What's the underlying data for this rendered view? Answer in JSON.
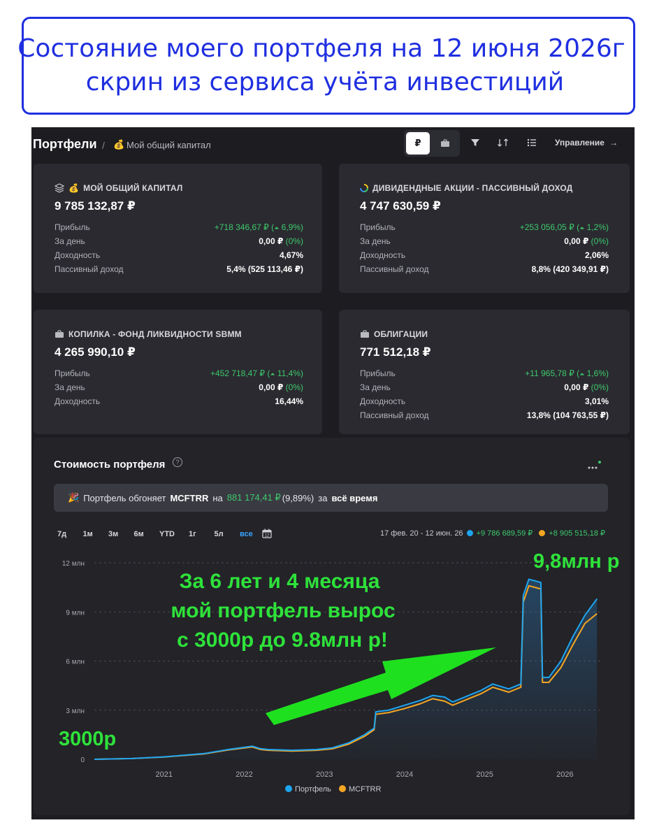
{
  "banner": {
    "line1": "Состояние моего портфеля на 12 июня 2026г",
    "line2": "скрин из сервиса учёта инвестиций"
  },
  "breadcrumb": {
    "title": "Портфели",
    "separator": "/",
    "icon": "money-bag-icon",
    "current": "Мой общий капитал"
  },
  "toolbar": {
    "currency_label": "₽",
    "manage_label": "Управление",
    "manage_arrow": "→"
  },
  "cards": [
    {
      "title": "МОЙ ОБЩИЙ КАПИТАЛ",
      "total": "9 785 132,87 ₽",
      "rows": [
        {
          "label": "Прибыль",
          "value": "+718 346,67 ₽ (",
          "pct": "6,9%",
          "tail": ")",
          "kind": "profit"
        },
        {
          "label": "За день",
          "value": "0,00 ₽ ",
          "pct": "(0%)",
          "kind": "day"
        },
        {
          "label": "Доходность",
          "value": "4,67%",
          "kind": "plain"
        },
        {
          "label": "Пассивный доход",
          "value": "5,4% (525 113,46 ₽)",
          "kind": "plain"
        }
      ]
    },
    {
      "title": "ДИВИДЕНДНЫЕ АКЦИИ - ПАССИВНЫЙ ДОХОД",
      "total": "4 747 630,59 ₽",
      "rows": [
        {
          "label": "Прибыль",
          "value": "+253 056,05 ₽ (",
          "pct": "1,2%",
          "tail": ")",
          "kind": "profit"
        },
        {
          "label": "За день",
          "value": "0,00 ₽ ",
          "pct": "(0%)",
          "kind": "day"
        },
        {
          "label": "Доходность",
          "value": "2,06%",
          "kind": "plain"
        },
        {
          "label": "Пассивный доход",
          "value": "8,8% (420 349,91 ₽)",
          "kind": "plain"
        }
      ]
    },
    {
      "title": "КОПИЛКА - ФОНД ЛИКВИДНОСТИ SBMM",
      "total": "4 265 990,10 ₽",
      "rows": [
        {
          "label": "Прибыль",
          "value": "+452 718,47 ₽ (",
          "pct": "11,4%",
          "tail": ")",
          "kind": "profit"
        },
        {
          "label": "За день",
          "value": "0,00 ₽ ",
          "pct": "(0%)",
          "kind": "day"
        },
        {
          "label": "Доходность",
          "value": "16,44%",
          "kind": "plain"
        }
      ]
    },
    {
      "title": "ОБЛИГАЦИИ",
      "total": "771 512,18 ₽",
      "rows": [
        {
          "label": "Прибыль",
          "value": "+11 965,78 ₽ (",
          "pct": "1,6%",
          "tail": ")",
          "kind": "profit"
        },
        {
          "label": "За день",
          "value": "0,00 ₽ ",
          "pct": "(0%)",
          "kind": "day"
        },
        {
          "label": "Доходность",
          "value": "3,01%",
          "kind": "plain"
        },
        {
          "label": "Пассивный доход",
          "value": "13,8% (104 763,55 ₽)",
          "kind": "plain"
        }
      ]
    }
  ],
  "chart_panel": {
    "title": "Стоимость портфеля",
    "help": "?",
    "notice": {
      "icon": "🎉",
      "pre": "Портфель обгоняет",
      "ticker": "MCFTRR",
      "mid": "на",
      "amount": "881 174,41 ₽",
      "pct": "(9,89%)",
      "post": "за",
      "period": "всё время"
    },
    "periods": [
      "7д",
      "1м",
      "3м",
      "6м",
      "YTD",
      "1г",
      "5л",
      "все"
    ],
    "active_period": "все",
    "range": "17 фев. 20 - 12 июн. 26",
    "portfolio_change": "+9 786 689,59 ₽",
    "index_change": "+8 905 515,18 ₽"
  },
  "annotations": {
    "start": "3000р",
    "end": "9,8млн р",
    "caption_l1": "За 6 лет и 4 месяца",
    "caption_l2": "мой портфель вырос",
    "caption_l3": "с 3000р до 9.8млн р!"
  },
  "colors": {
    "portfolio": "#1ea5f0",
    "index": "#f5a623",
    "annotation": "#2ee23a",
    "accent": "#3aa5ff",
    "profit": "#3ec96c"
  },
  "chart_data": {
    "type": "line",
    "y_ticks": [
      "0",
      "3 млн",
      "6 млн",
      "9 млн",
      "12 млн"
    ],
    "y_tick_values": [
      0,
      3,
      6,
      9,
      12
    ],
    "x_ticks": [
      "2021",
      "2022",
      "2023",
      "2024",
      "2025",
      "2026"
    ],
    "x_tick_values": [
      2021,
      2022,
      2023,
      2024,
      2025,
      2026
    ],
    "xlim": [
      2020.13,
      2026.45
    ],
    "ylim": [
      0,
      12
    ],
    "y_unit": "млн ₽",
    "legend": [
      "Портфель",
      "MCFTRR"
    ],
    "legend_position": "bottom",
    "series": [
      {
        "name": "Портфель",
        "x": [
          2020.13,
          2020.6,
          2021.0,
          2021.5,
          2021.8,
          2021.95,
          2022.1,
          2022.2,
          2022.3,
          2022.6,
          2022.9,
          2023.1,
          2023.3,
          2023.5,
          2023.62,
          2023.64,
          2023.8,
          2024.0,
          2024.2,
          2024.35,
          2024.5,
          2024.6,
          2024.8,
          2024.95,
          2025.1,
          2025.3,
          2025.45,
          2025.48,
          2025.55,
          2025.7,
          2025.72,
          2025.8,
          2025.95,
          2026.1,
          2026.25,
          2026.4
        ],
        "y": [
          0.0,
          0.05,
          0.15,
          0.35,
          0.6,
          0.7,
          0.8,
          0.65,
          0.6,
          0.55,
          0.6,
          0.7,
          1.0,
          1.5,
          1.9,
          2.9,
          3.0,
          3.3,
          3.6,
          3.9,
          3.8,
          3.5,
          3.9,
          4.2,
          4.6,
          4.3,
          4.6,
          10.0,
          11.0,
          10.8,
          5.0,
          5.0,
          6.0,
          7.5,
          8.8,
          9.8
        ]
      },
      {
        "name": "MCFTRR",
        "x": [
          2020.13,
          2020.6,
          2021.0,
          2021.5,
          2021.8,
          2021.95,
          2022.1,
          2022.2,
          2022.3,
          2022.6,
          2022.9,
          2023.1,
          2023.3,
          2023.5,
          2023.62,
          2023.64,
          2023.8,
          2024.0,
          2024.2,
          2024.35,
          2024.5,
          2024.6,
          2024.8,
          2024.95,
          2025.1,
          2025.3,
          2025.45,
          2025.48,
          2025.55,
          2025.7,
          2025.72,
          2025.8,
          2025.95,
          2026.1,
          2026.25,
          2026.4
        ],
        "y": [
          0.0,
          0.05,
          0.14,
          0.33,
          0.57,
          0.66,
          0.75,
          0.6,
          0.55,
          0.5,
          0.55,
          0.64,
          0.92,
          1.4,
          1.8,
          2.75,
          2.85,
          3.1,
          3.4,
          3.7,
          3.55,
          3.3,
          3.7,
          4.0,
          4.4,
          4.1,
          4.4,
          9.6,
          10.6,
          10.4,
          4.7,
          4.7,
          5.6,
          7.0,
          8.3,
          8.9
        ]
      }
    ]
  }
}
